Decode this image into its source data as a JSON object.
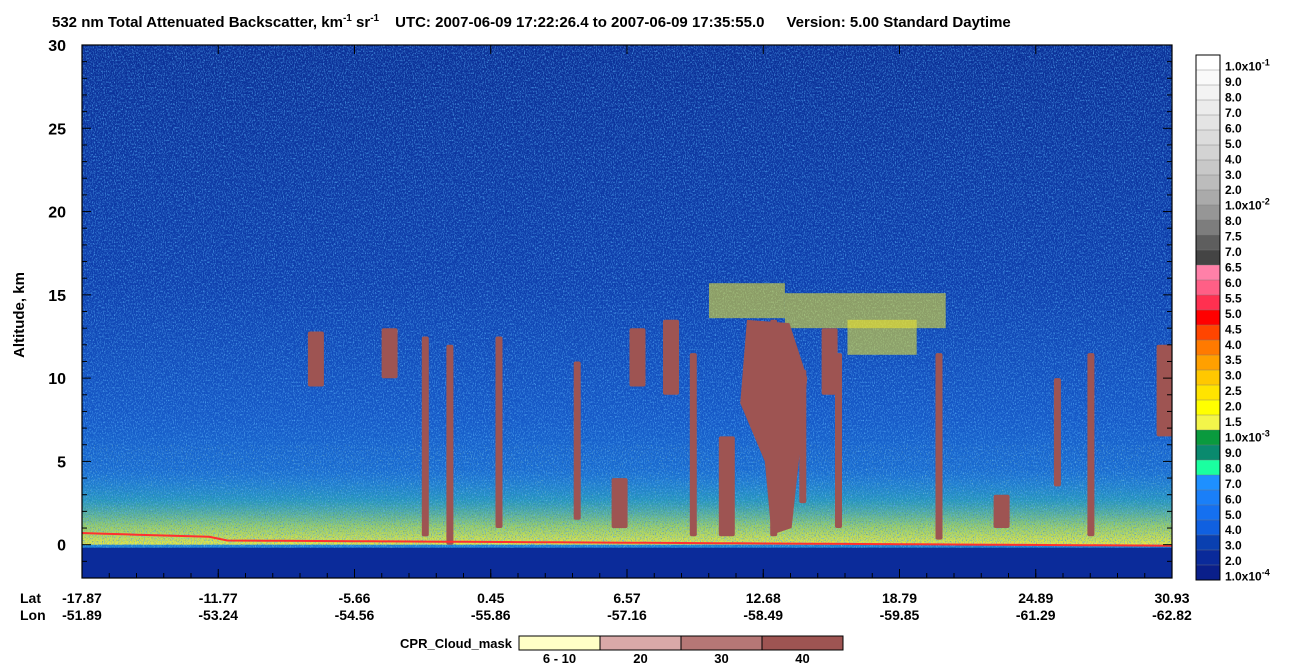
{
  "chart_data": {
    "type": "heatmap",
    "title": {
      "main": "532 nm Total Attenuated Backscatter, km",
      "km_exp": "-1",
      "sr": " sr",
      "sr_exp": "-1",
      "utc": "UTC:  2007-06-09 17:22:26.4  to  2007-06-09 17:35:55.0",
      "version": "Version: 5.00  Standard  Daytime"
    },
    "ylabel": "Altitude, km",
    "ylim": [
      -2,
      30
    ],
    "yticks": [
      0,
      5,
      10,
      15,
      20,
      25,
      30
    ],
    "x_row_labels": [
      "Lat",
      "Lon"
    ],
    "x_ticks": [
      {
        "lat": "-17.87",
        "lon": "-51.89"
      },
      {
        "lat": "-11.77",
        "lon": "-53.24"
      },
      {
        "lat": "-5.66",
        "lon": "-54.56"
      },
      {
        "lat": "0.45",
        "lon": "-55.86"
      },
      {
        "lat": "6.57",
        "lon": "-57.16"
      },
      {
        "lat": "12.68",
        "lon": "-58.49"
      },
      {
        "lat": "18.79",
        "lon": "-59.85"
      },
      {
        "lat": "24.89",
        "lon": "-61.29"
      },
      {
        "lat": "30.93",
        "lon": "-62.82"
      }
    ],
    "colorbar": {
      "units": "km-1 sr-1",
      "labels": [
        {
          "text": "1.0x10",
          "exp": "-1"
        },
        {
          "text": "9.0"
        },
        {
          "text": "8.0"
        },
        {
          "text": "7.0"
        },
        {
          "text": "6.0"
        },
        {
          "text": "5.0"
        },
        {
          "text": "4.0"
        },
        {
          "text": "3.0"
        },
        {
          "text": "2.0"
        },
        {
          "text": "1.0x10",
          "exp": "-2"
        },
        {
          "text": "8.0"
        },
        {
          "text": "7.5"
        },
        {
          "text": "7.0"
        },
        {
          "text": "6.5"
        },
        {
          "text": "6.0"
        },
        {
          "text": "5.5"
        },
        {
          "text": "5.0"
        },
        {
          "text": "4.5"
        },
        {
          "text": "4.0"
        },
        {
          "text": "3.5"
        },
        {
          "text": "3.0"
        },
        {
          "text": "2.5"
        },
        {
          "text": "2.0"
        },
        {
          "text": "1.5"
        },
        {
          "text": "1.0x10",
          "exp": "-3"
        },
        {
          "text": "9.0"
        },
        {
          "text": "8.0"
        },
        {
          "text": "7.0"
        },
        {
          "text": "6.0"
        },
        {
          "text": "5.0"
        },
        {
          "text": "4.0"
        },
        {
          "text": "3.0"
        },
        {
          "text": "2.0"
        },
        {
          "text": "1.0x10",
          "exp": "-4"
        }
      ],
      "colors": [
        "#ffffff",
        "#fafafa",
        "#f3f3f3",
        "#ececec",
        "#e4e4e4",
        "#dcdcdc",
        "#d3d3d3",
        "#c8c8c8",
        "#bcbcbc",
        "#aaaaaa",
        "#969696",
        "#7d7d7d",
        "#5e5e5e",
        "#444444",
        "#ff80a8",
        "#ff5f86",
        "#ff3050",
        "#ff0000",
        "#ff4500",
        "#ff7a00",
        "#ffa000",
        "#ffc800",
        "#ffe400",
        "#ffff00",
        "#f3f54a",
        "#0a9a3e",
        "#0a8a6e",
        "#1affa0",
        "#1e90ff",
        "#1a7ff8",
        "#1570f0",
        "#1060e0",
        "#0a40b0",
        "#0a2a9a",
        "#0a1f8a"
      ]
    },
    "cloud_mask_legend": {
      "title": "CPR_Cloud_mask",
      "items": [
        {
          "label": "6 - 10",
          "color": "#ffffc6"
        },
        {
          "label": "20",
          "color": "#d9a9a8"
        },
        {
          "label": "30",
          "color": "#b67776"
        },
        {
          "label": "40",
          "color": "#9e5452"
        }
      ]
    },
    "cpr_cloud_regions": [
      {
        "lat": -7.4,
        "base_km": 9.5,
        "top_km": 12.8
      },
      {
        "lat": -4.1,
        "base_km": 10.0,
        "top_km": 13.0
      },
      {
        "lat": -2.5,
        "base_km": 0.5,
        "top_km": 12.5
      },
      {
        "lat": -1.4,
        "base_km": 0.0,
        "top_km": 12.0
      },
      {
        "lat": 0.8,
        "base_km": 1.0,
        "top_km": 12.5
      },
      {
        "lat": 4.3,
        "base_km": 1.5,
        "top_km": 11.0
      },
      {
        "lat": 6.2,
        "base_km": 1.0,
        "top_km": 4.0
      },
      {
        "lat": 7.0,
        "base_km": 9.5,
        "top_km": 13.0
      },
      {
        "lat": 8.5,
        "base_km": 9.0,
        "top_km": 13.5
      },
      {
        "lat": 9.5,
        "base_km": 0.5,
        "top_km": 11.5
      },
      {
        "lat": 11.0,
        "base_km": 0.5,
        "top_km": 6.5
      },
      {
        "lat": 13.1,
        "base_km": 0.5,
        "top_km": 13.5
      },
      {
        "lat": 14.4,
        "base_km": 2.5,
        "top_km": 10.5
      },
      {
        "lat": 15.6,
        "base_km": 9.0,
        "top_km": 13.0
      },
      {
        "lat": 16.0,
        "base_km": 1.0,
        "top_km": 11.5
      },
      {
        "lat": 20.5,
        "base_km": 0.3,
        "top_km": 11.5
      },
      {
        "lat": 23.3,
        "base_km": 1.0,
        "top_km": 3.0
      },
      {
        "lat": 25.8,
        "base_km": 3.5,
        "top_km": 10.0
      },
      {
        "lat": 27.3,
        "base_km": 0.5,
        "top_km": 11.5
      },
      {
        "lat": 30.6,
        "base_km": 6.5,
        "top_km": 12.0
      }
    ],
    "grid": false
  }
}
